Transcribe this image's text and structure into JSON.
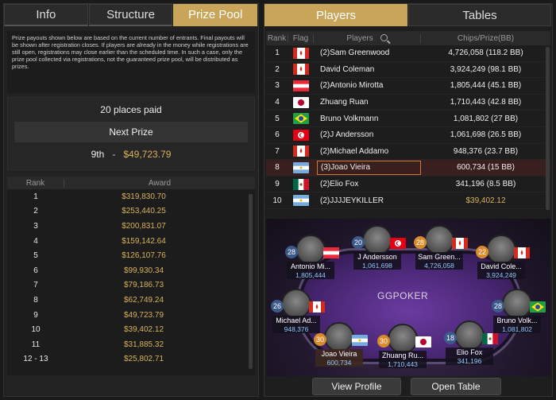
{
  "left_tabs": [
    "Info",
    "Structure",
    "Prize Pool"
  ],
  "notice": "Prize payouts shown below are based on the current number of entrants. Final payouts will be shown after registration closes. If players are already in the money while registrations are still open, registrations may close earlier than the scheduled time. In such a case, only the prize pool collected via registrations, not the guaranteed prize pool, will be distributed as prizes.",
  "summary": {
    "places_paid": "20 places paid",
    "next_prize_label": "Next Prize",
    "next_rank": "9th",
    "dash": "-",
    "next_amount": "$49,723.79"
  },
  "award_table": {
    "headers": [
      "Rank",
      "Award"
    ],
    "rows": [
      {
        "rank": "1",
        "award": "$319,830.70"
      },
      {
        "rank": "2",
        "award": "$253,440.25"
      },
      {
        "rank": "3",
        "award": "$200,831.07"
      },
      {
        "rank": "4",
        "award": "$159,142.64"
      },
      {
        "rank": "5",
        "award": "$126,107.76"
      },
      {
        "rank": "6",
        "award": "$99,930.34"
      },
      {
        "rank": "7",
        "award": "$79,186.73"
      },
      {
        "rank": "8",
        "award": "$62,749.24"
      },
      {
        "rank": "9",
        "award": "$49,723.79"
      },
      {
        "rank": "10",
        "award": "$39,402.12"
      },
      {
        "rank": "11",
        "award": "$31,885.32"
      },
      {
        "rank": "12 - 13",
        "award": "$25,802.71"
      }
    ]
  },
  "right_tabs": [
    "Players",
    "Tables"
  ],
  "players_table": {
    "headers": [
      "Rank",
      "Flag",
      "Players",
      "Chips/Prize(BB)"
    ],
    "rows": [
      {
        "rank": "1",
        "flag": "canada",
        "name": "(2)Sam Greenwood",
        "chips": "4,726,058 (118.2 BB)"
      },
      {
        "rank": "2",
        "flag": "canada",
        "name": "David Coleman",
        "chips": "3,924,249 (98.1 BB)"
      },
      {
        "rank": "3",
        "flag": "austria",
        "name": "(2)Antonio Mirotta",
        "chips": "1,805,444 (45.1 BB)"
      },
      {
        "rank": "4",
        "flag": "japan",
        "name": "Zhuang Ruan",
        "chips": "1,710,443 (42.8 BB)"
      },
      {
        "rank": "5",
        "flag": "brazil",
        "name": "Bruno Volkmann",
        "chips": "1,081,802 (27 BB)"
      },
      {
        "rank": "6",
        "flag": "tunisia",
        "name": "(2)J Andersson",
        "chips": "1,061,698 (26.5 BB)"
      },
      {
        "rank": "7",
        "flag": "canada",
        "name": "(2)Michael Addamo",
        "chips": "948,376 (23.7 BB)"
      },
      {
        "rank": "8",
        "flag": "argentina",
        "name": "(3)Joao Vieira",
        "chips": "600,734 (15 BB)"
      },
      {
        "rank": "9",
        "flag": "mexico",
        "name": "(2)Elio Fox",
        "chips": "341,196 (8.5 BB)"
      },
      {
        "rank": "10",
        "flag": "argentina",
        "name": "(2)JJJJEYKILLER",
        "chips": "$39,402.12"
      }
    ]
  },
  "table_view": {
    "logo": "GGPOKER",
    "seats": [
      {
        "name": "Antonio Mi...",
        "stack": "1,805,444",
        "level": "28"
      },
      {
        "name": "J Andersson",
        "stack": "1,061,698",
        "level": "20"
      },
      {
        "name": "Sam Green...",
        "stack": "4,726,058",
        "level": "28"
      },
      {
        "name": "David Cole...",
        "stack": "3,924,249",
        "level": "22"
      },
      {
        "name": "Michael Ad...",
        "stack": "948,376",
        "level": "26"
      },
      {
        "name": "Bruno Volk...",
        "stack": "1,081,802",
        "level": "28"
      },
      {
        "name": "Joao Vieira",
        "stack": "600,734",
        "level": "30"
      },
      {
        "name": "Zhuang Ru...",
        "stack": "1,710,443",
        "level": "30"
      },
      {
        "name": "Elio Fox",
        "stack": "341,196",
        "level": "18"
      }
    ]
  },
  "buttons": {
    "view_profile": "View Profile",
    "open_table": "Open Table"
  },
  "colors": {
    "accent_gold": "#c9a55a",
    "prize_gold": "#d7b35d",
    "stack_blue": "#8fc8ff",
    "felt_purple": "#4a2775"
  }
}
